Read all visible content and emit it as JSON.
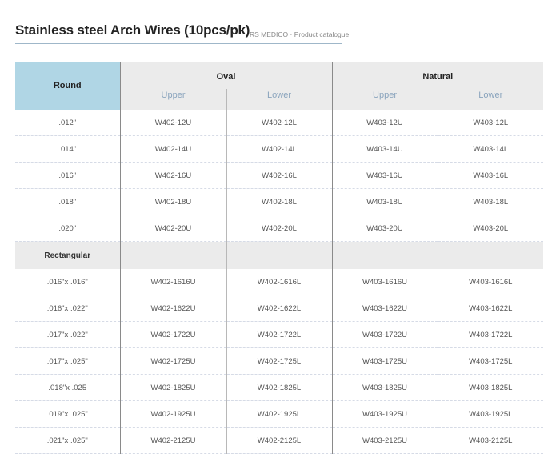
{
  "header": {
    "title": "Stainless steel Arch Wires (10pcs/pk)",
    "subtitle": "RS MEDICO · Product catalogue"
  },
  "table": {
    "round_label": "Round",
    "groups": [
      "Oval",
      "Natural"
    ],
    "subheaders": [
      "Upper",
      "Lower",
      "Upper",
      "Lower"
    ],
    "round_rows": [
      [
        ".012\"",
        "W402-12U",
        "W402-12L",
        "W403-12U",
        "W403-12L"
      ],
      [
        ".014\"",
        "W402-14U",
        "W402-14L",
        "W403-14U",
        "W403-14L"
      ],
      [
        ".016\"",
        "W402-16U",
        "W402-16L",
        "W403-16U",
        "W403-16L"
      ],
      [
        ".018\"",
        "W402-18U",
        "W402-18L",
        "W403-18U",
        "W403-18L"
      ],
      [
        ".020\"",
        "W402-20U",
        "W402-20L",
        "W403-20U",
        "W403-20L"
      ]
    ],
    "rect_label": "Rectangular",
    "rect_rows": [
      [
        ".016\"x .016\"",
        "W402-1616U",
        "W402-1616L",
        "W403-1616U",
        "W403-1616L"
      ],
      [
        ".016\"x .022\"",
        "W402-1622U",
        "W402-1622L",
        "W403-1622U",
        "W403-1622L"
      ],
      [
        ".017\"x .022\"",
        "W402-1722U",
        "W402-1722L",
        "W403-1722U",
        "W403-1722L"
      ],
      [
        ".017\"x .025\"",
        "W402-1725U",
        "W402-1725L",
        "W403-1725U",
        "W403-1725L"
      ],
      [
        ".018\"x .025",
        "W402-1825U",
        "W402-1825L",
        "W403-1825U",
        "W403-1825L"
      ],
      [
        ".019\"x .025\"",
        "W402-1925U",
        "W402-1925L",
        "W403-1925U",
        "W403-1925L"
      ],
      [
        ".021\"x .025\"",
        "W402-2125U",
        "W402-2125L",
        "W403-2125U",
        "W403-2125L"
      ]
    ]
  }
}
